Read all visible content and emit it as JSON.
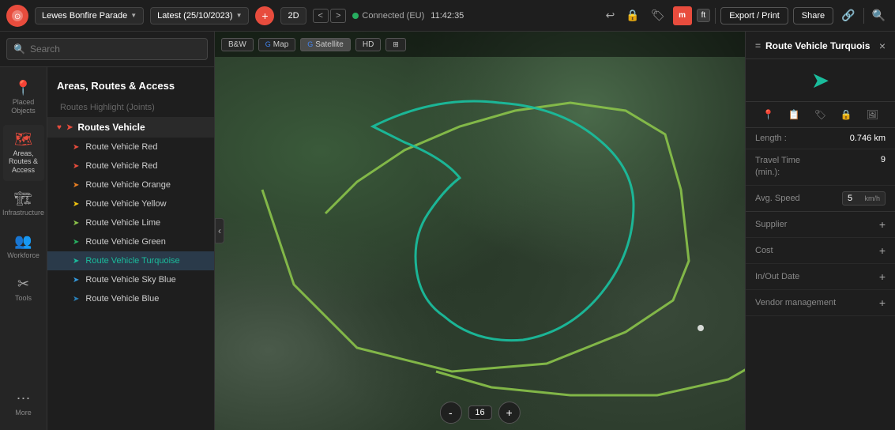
{
  "app": {
    "logo_color": "#e84c3d"
  },
  "top_bar": {
    "project_label": "Lewes Bonfire Parade",
    "date_label": "Latest (25/10/2023)",
    "add_icon": "+",
    "view_2d": "2D",
    "nav_left": "<",
    "nav_right": ">",
    "status_text": "Connected (EU)",
    "time": "11:42:35",
    "export_print": "Export / Print",
    "share": "Share",
    "user_initials": "m",
    "unit_m": "m",
    "unit_ft": "ft"
  },
  "search": {
    "placeholder": "Search"
  },
  "sidebar": {
    "icons": [
      {
        "id": "placed-objects",
        "symbol": "📍",
        "label": "Placed\nObjects",
        "active": false
      },
      {
        "id": "areas-routes",
        "symbol": "🗺",
        "label": "Areas, Routes\n& Access",
        "active": true
      },
      {
        "id": "infrastructure",
        "symbol": "🏗",
        "label": "Infrastructure",
        "active": false
      },
      {
        "id": "workforce",
        "symbol": "👥",
        "label": "Workforce",
        "active": false
      },
      {
        "id": "tools",
        "symbol": "🔧",
        "label": "Tools",
        "active": false
      },
      {
        "id": "more",
        "symbol": "⋯",
        "label": "More",
        "active": false
      }
    ],
    "section_title": "Areas, Routes & Access",
    "items": [
      {
        "id": "routes-highlight",
        "label": "Routes Highlight (Joints)",
        "indent": 0,
        "color": null,
        "arrow": null
      },
      {
        "id": "routes-vehicle-header",
        "label": "Routes Vehicle",
        "indent": 0,
        "color": "#e84c3d",
        "arrow": "heart",
        "bold": true,
        "selected": true
      },
      {
        "id": "route-red-1",
        "label": "Route Vehicle Red",
        "indent": 1,
        "color": "#e74c3c",
        "arrow": "red"
      },
      {
        "id": "route-red-2",
        "label": "Route Vehicle Red",
        "indent": 1,
        "color": "#e74c3c",
        "arrow": "red"
      },
      {
        "id": "route-orange",
        "label": "Route Vehicle Orange",
        "indent": 1,
        "color": "#e67e22",
        "arrow": "orange"
      },
      {
        "id": "route-yellow",
        "label": "Route Vehicle Yellow",
        "indent": 1,
        "color": "#f1c40f",
        "arrow": "yellow"
      },
      {
        "id": "route-lime",
        "label": "Route Vehicle Lime",
        "indent": 1,
        "color": "#8bc34a",
        "arrow": "lime"
      },
      {
        "id": "route-green",
        "label": "Route Vehicle Green",
        "indent": 1,
        "color": "#27ae60",
        "arrow": "green"
      },
      {
        "id": "route-turquoise",
        "label": "Route Vehicle Turquoise",
        "indent": 1,
        "color": "#1abc9c",
        "arrow": "teal",
        "selected": true
      },
      {
        "id": "route-sky",
        "label": "Route Vehicle Sky Blue",
        "indent": 1,
        "color": "#3498db",
        "arrow": "sky"
      },
      {
        "id": "route-blue",
        "label": "Route Vehicle Blue",
        "indent": 1,
        "color": "#2980b9",
        "arrow": "blue"
      }
    ]
  },
  "map": {
    "buttons": [
      "B&W",
      "Map",
      "Satellite",
      "HD"
    ],
    "zoom_level": "16",
    "zoom_in": "+",
    "zoom_out": "-"
  },
  "right_panel": {
    "title": "Route Vehicle Turquois",
    "close": "×",
    "length_label": "Length :",
    "length_value": "0.746 km",
    "travel_time_label": "Travel Time\n(min.):",
    "travel_time_value": "9",
    "avg_speed_label": "Avg. Speed",
    "avg_speed_value": "5",
    "avg_speed_unit": "km/h",
    "supplier_label": "Supplier",
    "cost_label": "Cost",
    "in_out_date_label": "In/Out Date",
    "vendor_label": "Vendor management",
    "expand_icon": "+"
  }
}
